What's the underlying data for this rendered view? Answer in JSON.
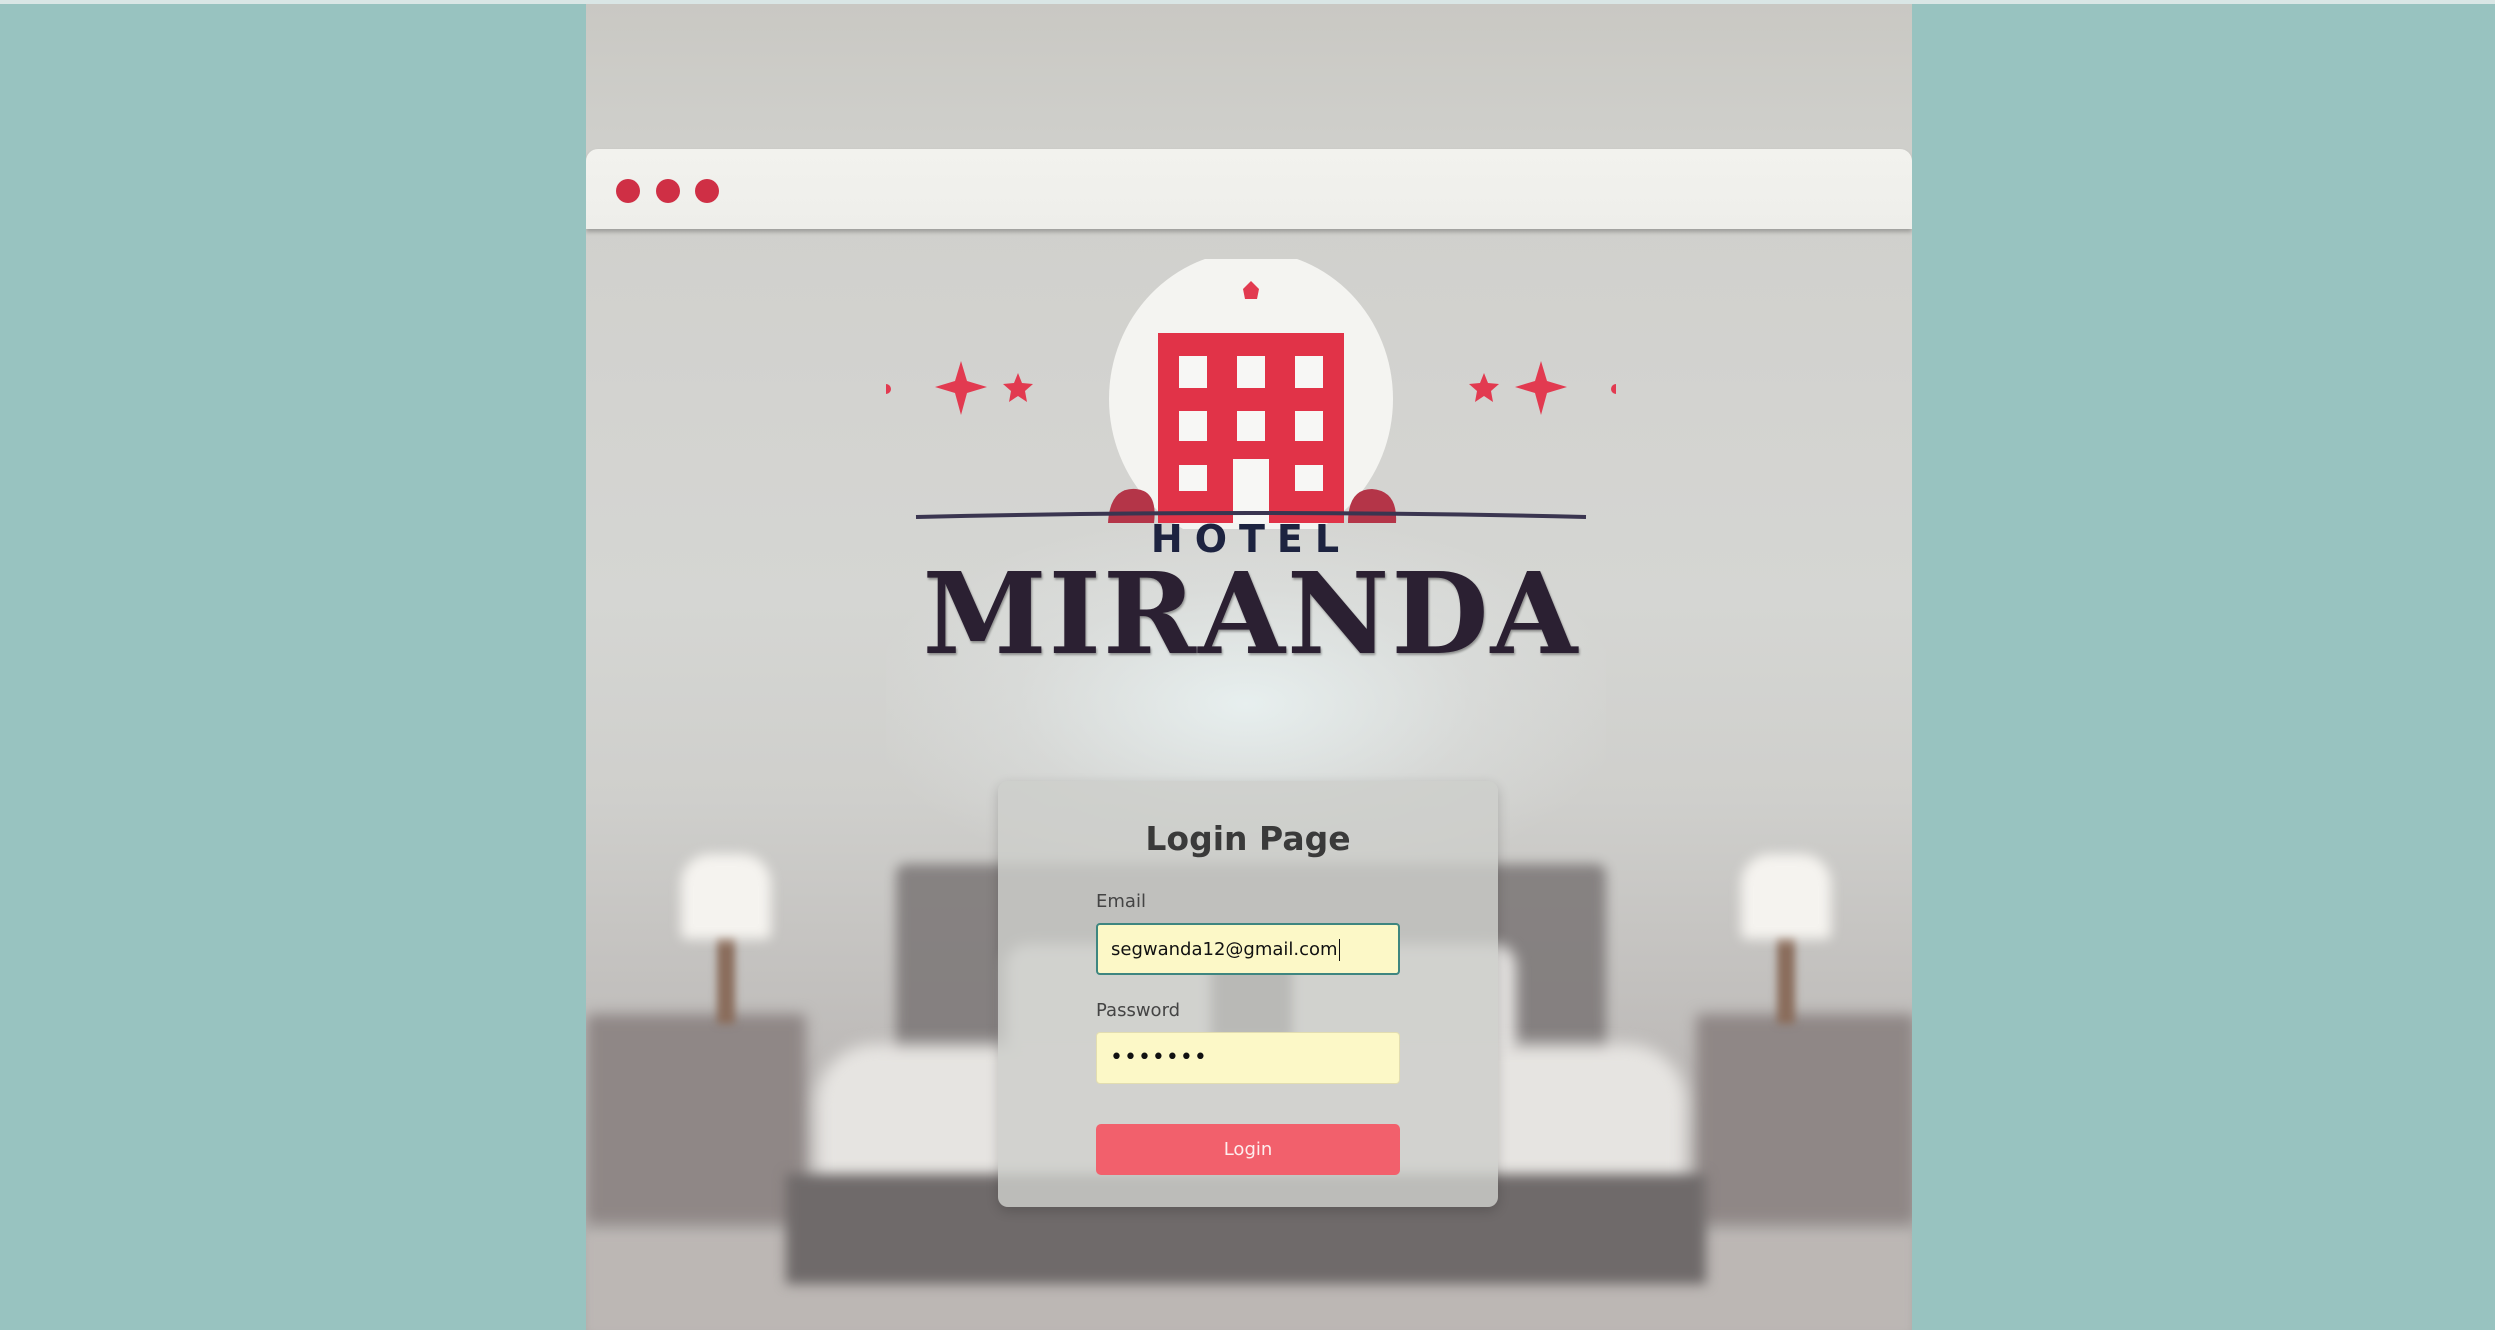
{
  "logo": {
    "line1": "HOTEL",
    "line2": "MIRANDA"
  },
  "login": {
    "title": "Login Page",
    "email_label": "Email",
    "email_value": "segwanda12@gmail.com",
    "password_label": "Password",
    "password_value": "•••••••",
    "button_label": "Login"
  },
  "colors": {
    "background": "#98c3c0",
    "accent": "#f2606c",
    "input_fill": "#fcf8c7",
    "window_dot": "#cf2f45"
  },
  "icons": [
    "hotel-building-icon",
    "sparkle-star-icon"
  ]
}
